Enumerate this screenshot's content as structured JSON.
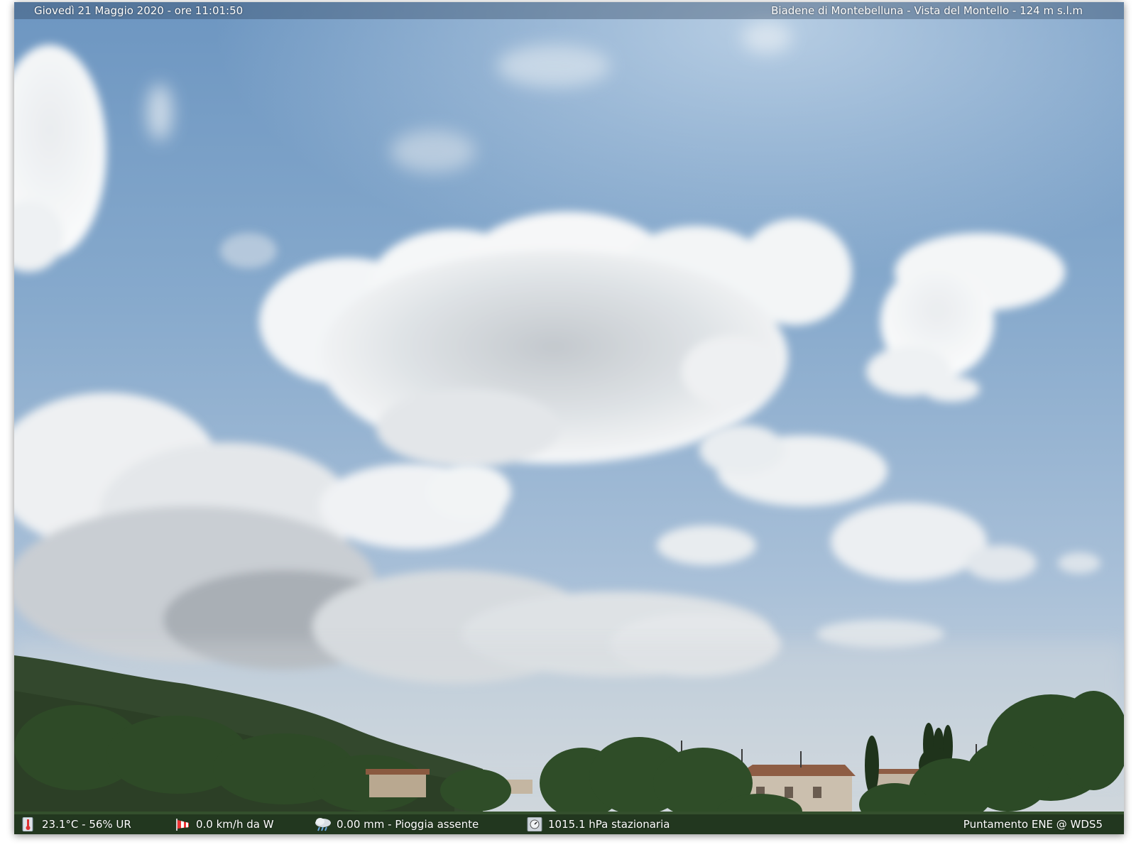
{
  "overlay": {
    "datetime": "Giovedì 21 Maggio 2020 - ore 11:01:50",
    "location": "Biadene di Montebelluna - Vista del Montello - 124 m s.l.m",
    "temperature_humidity": "23.1°C - 56% UR",
    "wind": "0.0 km/h da W",
    "rain": "0.00 mm - Pioggia assente",
    "pressure": "1015.1 hPa stazionaria",
    "pointing": "Puntamento ENE  @ WDS5"
  },
  "icons": {
    "temperature": "thermometer-icon",
    "wind": "windsock-icon",
    "rain": "rain-cloud-icon",
    "pressure": "barometer-icon"
  },
  "colors": {
    "sky_top": "#6f98c2",
    "sky_bottom": "#cfd6dc",
    "cloud": "#f4f6f8",
    "vegetation": "#2c4526"
  }
}
